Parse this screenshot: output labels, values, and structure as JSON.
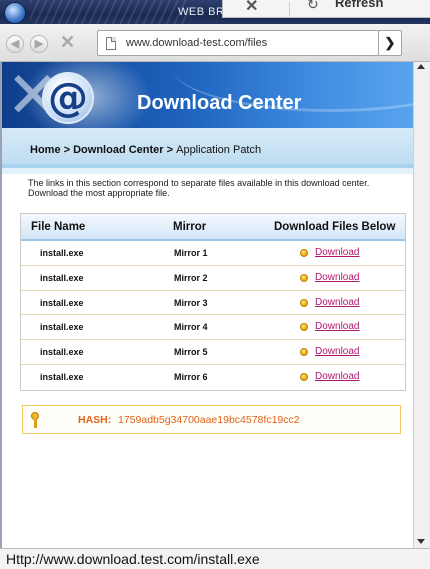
{
  "window": {
    "title": "WEB BR",
    "panel_text": "Refresh",
    "panel_close": "✕",
    "panel_arrow": "↻"
  },
  "nav": {
    "back": "◀",
    "forward": "▶",
    "stop": "✕",
    "url": "www.download-test.com/files",
    "go": "❯"
  },
  "banner": {
    "title": "Download Center",
    "at_symbol": "@"
  },
  "breadcrumb": {
    "home": "Home",
    "sep1": " > ",
    "section": "Download Center",
    "sep2": " > ",
    "current": "Application Patch"
  },
  "intro": "The links in this section correspond to separate files available in this download center. Download the most appropriate file.",
  "table": {
    "headers": [
      "File Name",
      "Mirror",
      "Download Files Below"
    ],
    "rows": [
      {
        "file": "install.exe",
        "mirror": "Mirror 1",
        "link": "Download"
      },
      {
        "file": "install.exe",
        "mirror": "Mirror 2",
        "link": "Download"
      },
      {
        "file": "install.exe",
        "mirror": "Mirror 3",
        "link": "Download"
      },
      {
        "file": "install.exe",
        "mirror": "Mirror 4",
        "link": "Download"
      },
      {
        "file": "install.exe",
        "mirror": "Mirror 5",
        "link": "Download"
      },
      {
        "file": "install.exe",
        "mirror": "Mirror 6",
        "link": "Download"
      }
    ]
  },
  "hash": {
    "label": "HASH:",
    "value": "1759adb5g34700aae19bc4578fc19cc2"
  },
  "status": {
    "text": "Http://www.download.test.com/install.exe"
  },
  "colors": {
    "banner": "#1e63be",
    "link": "#b0186c",
    "hash": "#e1611b"
  }
}
